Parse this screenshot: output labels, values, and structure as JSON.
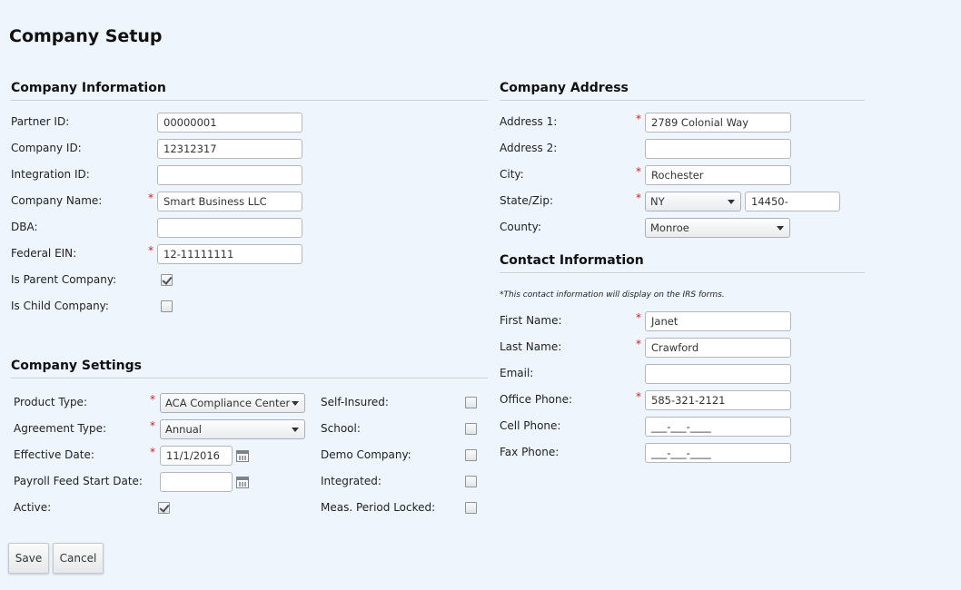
{
  "page": {
    "title": "Company Setup"
  },
  "company_info": {
    "title": "Company Information",
    "partner_id": {
      "label": "Partner ID:",
      "value": "00000001"
    },
    "company_id": {
      "label": "Company ID:",
      "value": "12312317"
    },
    "integration_id": {
      "label": "Integration ID:",
      "value": ""
    },
    "company_name": {
      "label": "Company Name:",
      "value": "Smart Business LLC",
      "required": true
    },
    "dba": {
      "label": "DBA:",
      "value": ""
    },
    "federal_ein": {
      "label": "Federal EIN:",
      "value": "12-11111111",
      "required": true
    },
    "is_parent": {
      "label": "Is Parent Company:",
      "checked": true
    },
    "is_child": {
      "label": "Is Child Company:",
      "checked": false
    }
  },
  "company_settings": {
    "title": "Company Settings",
    "product_type": {
      "label": "Product Type:",
      "value": "ACA Compliance Center",
      "required": true
    },
    "agreement_type": {
      "label": "Agreement Type:",
      "value": "Annual",
      "required": true
    },
    "effective_date": {
      "label": "Effective Date:",
      "value": "11/1/2016",
      "required": true
    },
    "payroll_feed_start": {
      "label": "Payroll Feed Start Date:",
      "value": ""
    },
    "active": {
      "label": "Active:",
      "checked": true
    },
    "self_insured": {
      "label": "Self-Insured:",
      "checked": false
    },
    "school": {
      "label": "School:",
      "checked": false
    },
    "demo_company": {
      "label": "Demo Company:",
      "checked": false
    },
    "integrated": {
      "label": "Integrated:",
      "checked": false
    },
    "meas_period_locked": {
      "label": "Meas. Period Locked:",
      "checked": false
    }
  },
  "company_address": {
    "title": "Company Address",
    "address1": {
      "label": "Address 1:",
      "value": "2789 Colonial Way",
      "required": true
    },
    "address2": {
      "label": "Address 2:",
      "value": ""
    },
    "city": {
      "label": "City:",
      "value": "Rochester",
      "required": true
    },
    "state_zip": {
      "label": "State/Zip:",
      "state": "NY",
      "zip": "14450-",
      "required": true
    },
    "county": {
      "label": "County:",
      "value": "Monroe"
    }
  },
  "contact_info": {
    "title": "Contact Information",
    "note": "*This contact information will display on the IRS forms.",
    "first_name": {
      "label": "First Name:",
      "value": "Janet",
      "required": true
    },
    "last_name": {
      "label": "Last Name:",
      "value": "Crawford",
      "required": true
    },
    "email": {
      "label": "Email:",
      "value": ""
    },
    "office_phone": {
      "label": "Office Phone:",
      "value": "585-321-2121",
      "required": true
    },
    "cell_phone": {
      "label": "Cell Phone:",
      "value": "___-___-____"
    },
    "fax_phone": {
      "label": "Fax Phone:",
      "value": "___-___-____"
    }
  },
  "actions": {
    "save": "Save",
    "cancel": "Cancel"
  },
  "icons": {
    "required_marker": "*",
    "calendar": "calendar-icon",
    "dropdown": "chevron-down-icon",
    "check": "check-icon"
  },
  "colors": {
    "background": "#eef5fd",
    "required": "#d21f1f"
  }
}
